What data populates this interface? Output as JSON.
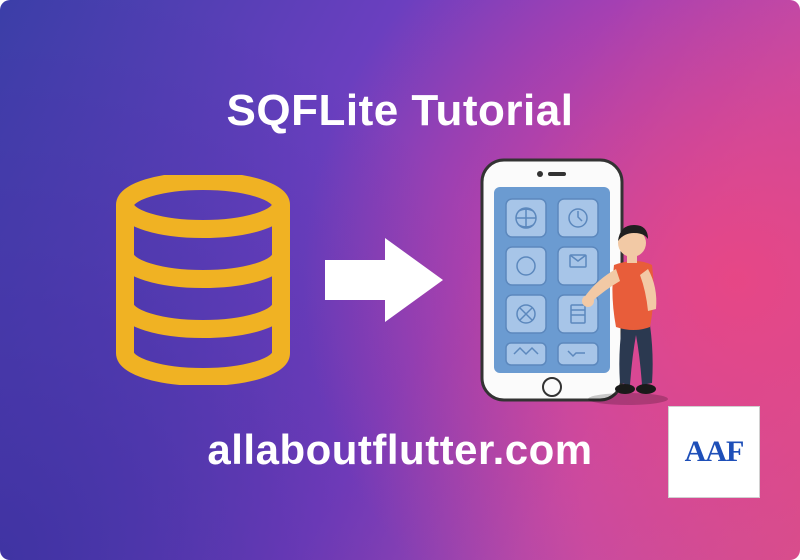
{
  "banner": {
    "title": "SQFLite Tutorial",
    "domain": "allaboutflutter.com",
    "logo_text": "AAF"
  },
  "icons": {
    "database": "database-icon",
    "arrow": "arrow-right-icon",
    "phone": "smartphone-icon",
    "person": "person-icon"
  },
  "colors": {
    "accent_yellow": "#f0b223",
    "arrow_white": "#ffffff",
    "phone_body": "#fdfdfd",
    "phone_bezel": "#2c2c2c",
    "phone_screen": "#6b9bd1",
    "app_tile": "#a7c5e8",
    "person_skin": "#f2c9a5",
    "person_shirt": "#e85d3a",
    "person_pants": "#2b3950",
    "person_hair": "#1f1f1f",
    "logo_blue": "#1e4fb8"
  }
}
